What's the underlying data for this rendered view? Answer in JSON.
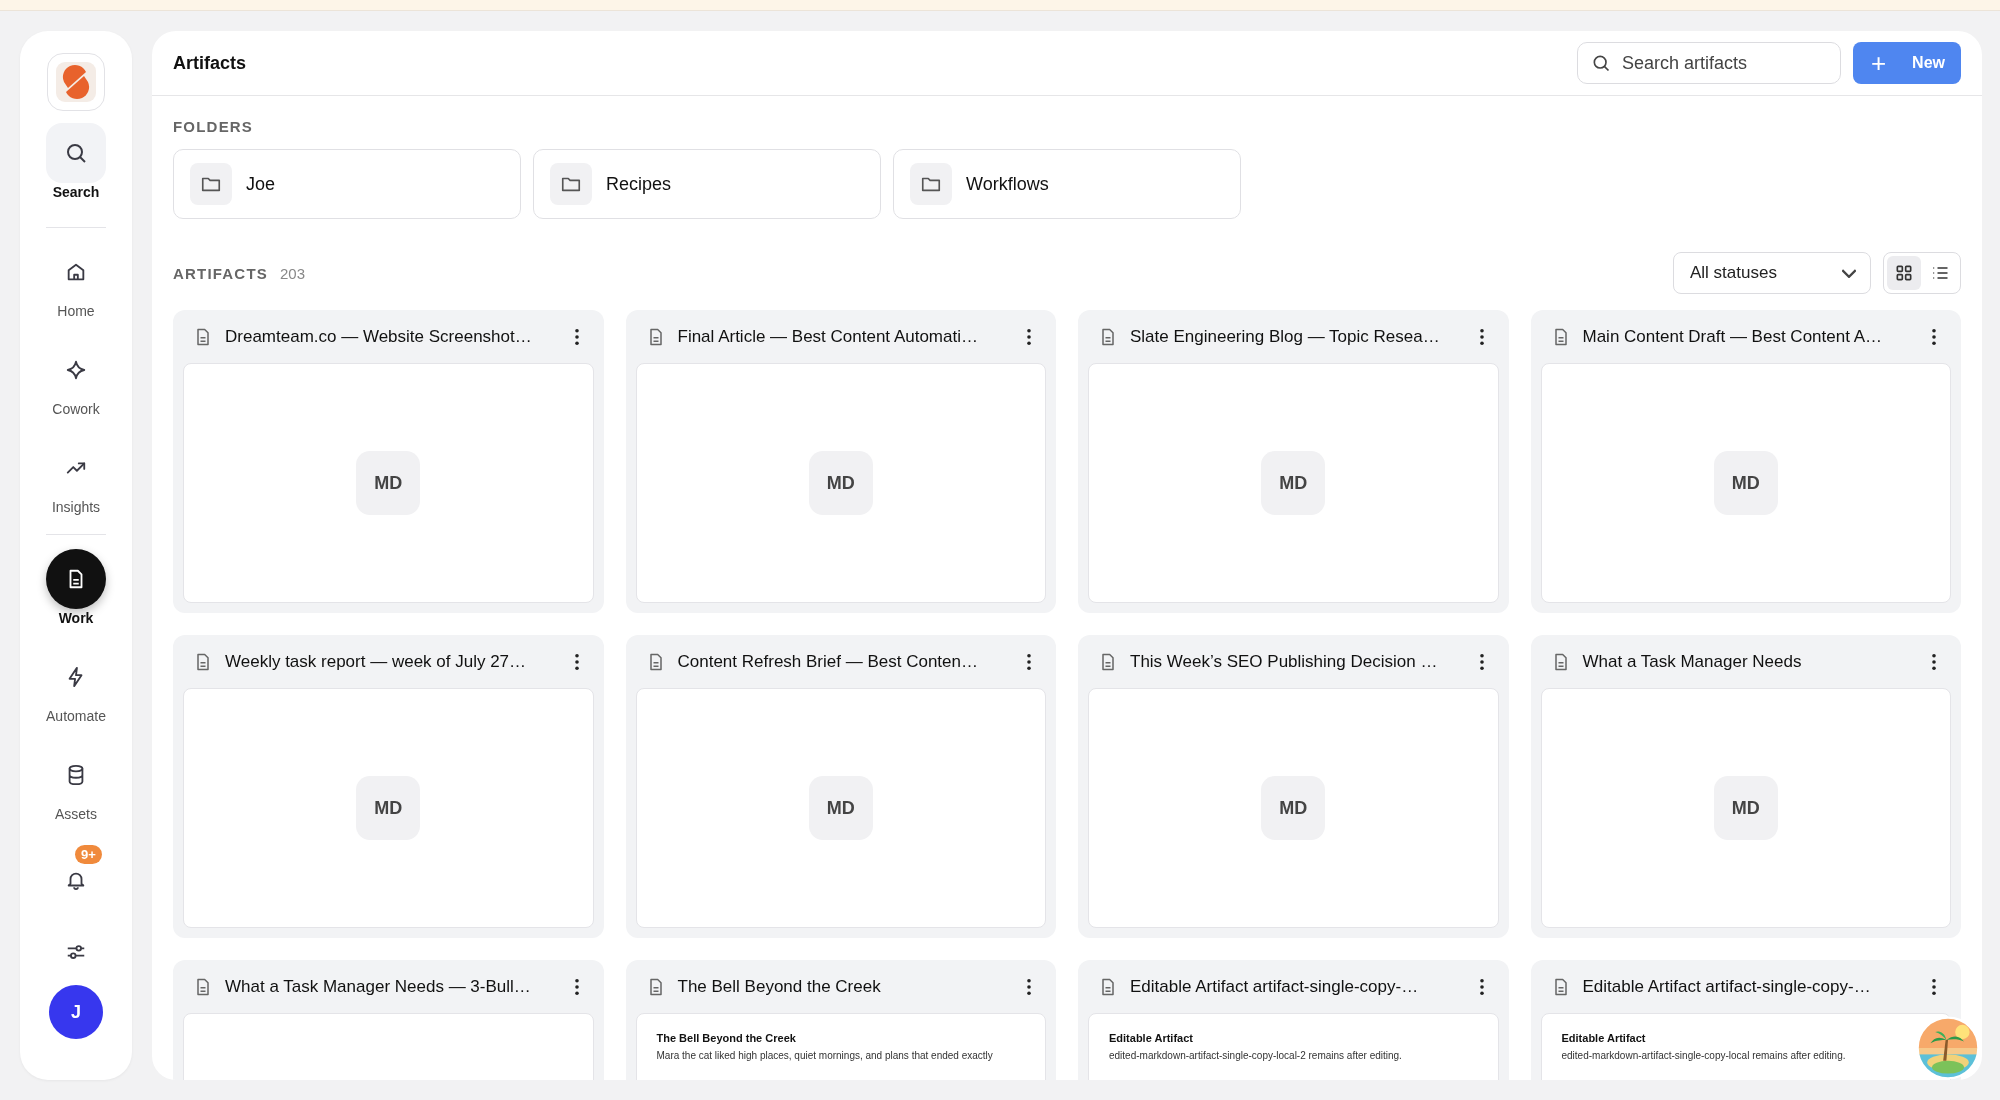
{
  "sidebar": {
    "search": {
      "label": "Search",
      "selected": false
    },
    "nav": [
      {
        "label": "Home",
        "selected": false
      },
      {
        "label": "Cowork",
        "selected": false
      },
      {
        "label": "Insights",
        "selected": false
      },
      {
        "label": "Work",
        "selected": true
      },
      {
        "label": "Automate",
        "selected": false
      },
      {
        "label": "Assets",
        "selected": false
      }
    ],
    "notifications": {
      "badge": "9+"
    },
    "avatar": {
      "initial": "J"
    }
  },
  "header": {
    "title": "Artifacts",
    "search": {
      "placeholder": "Search artifacts"
    },
    "new_button": {
      "icon": "+",
      "label": "New"
    }
  },
  "folders": {
    "heading": "FOLDERS",
    "items": [
      {
        "name": "Joe"
      },
      {
        "name": "Recipes"
      },
      {
        "name": "Workflows"
      }
    ]
  },
  "artifacts": {
    "heading": "ARTIFACTS",
    "count": "203",
    "status_filter": "All statuses",
    "views": [
      {
        "selected": true
      },
      {
        "selected": false
      }
    ],
    "cards": [
      {
        "title": "Dreamteam.co — Website Screenshot…",
        "kind": "badge",
        "badge": "MD"
      },
      {
        "title": "Final Article — Best Content Automati…",
        "kind": "badge",
        "badge": "MD"
      },
      {
        "title": "Slate Engineering Blog — Topic Resea…",
        "kind": "badge",
        "badge": "MD"
      },
      {
        "title": "Main Content Draft — Best Content A…",
        "kind": "badge",
        "badge": "MD"
      },
      {
        "title": "Weekly task report — week of July 27…",
        "kind": "badge",
        "badge": "MD"
      },
      {
        "title": "Content Refresh Brief — Best Conten…",
        "kind": "badge",
        "badge": "MD"
      },
      {
        "title": "This Week’s SEO Publishing Decision …",
        "kind": "badge",
        "badge": "MD"
      },
      {
        "title": "What a Task Manager Needs",
        "kind": "badge",
        "badge": "MD"
      },
      {
        "title": "What a Task Manager Needs — 3-Bull…",
        "kind": "blank"
      },
      {
        "title": "The Bell Beyond the Creek",
        "kind": "doc",
        "heading": "The Bell Beyond the Creek",
        "body": "Mara the cat liked high places, quiet mornings, and plans that ended exactly"
      },
      {
        "title": "Editable Artifact artifact-single-copy-…",
        "kind": "doc",
        "heading": "Editable Artifact",
        "body": "edited-markdown-artifact-single-copy-local-2 remains after editing."
      },
      {
        "title": "Editable Artifact artifact-single-copy-…",
        "kind": "doc",
        "heading": "Editable Artifact",
        "body": "edited-markdown-artifact-single-copy-local remains after editing."
      }
    ]
  }
}
